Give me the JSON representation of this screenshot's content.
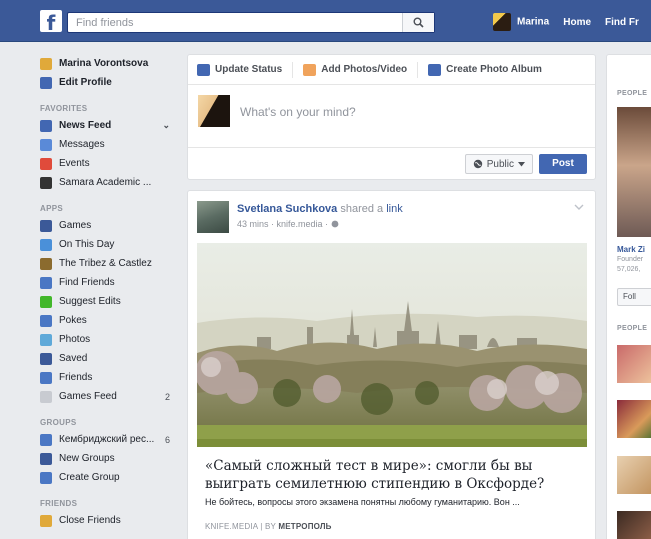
{
  "topbar": {
    "logo": "f",
    "search_placeholder": "Find friends",
    "user_name": "Marina",
    "home_label": "Home",
    "find_friends_label": "Find Fr"
  },
  "sidebar": {
    "profile": [
      {
        "label": "Marina Vorontsova",
        "icon": "avatar",
        "color": "#e0a93a"
      },
      {
        "label": "Edit Profile",
        "icon": "edit-icon",
        "color": "#4267b2"
      }
    ],
    "favorites_heading": "FAVORITES",
    "favorites": [
      {
        "label": "News Feed",
        "icon": "news-feed-icon",
        "color": "#4267b2",
        "count": "⌄"
      },
      {
        "label": "Messages",
        "icon": "messages-icon",
        "color": "#5a8ad8",
        "count": ""
      },
      {
        "label": "Events",
        "icon": "events-icon",
        "color": "#e04b3b",
        "count": ""
      },
      {
        "label": "Samara Academic ...",
        "icon": "group-icon",
        "color": "#333333",
        "count": ""
      }
    ],
    "apps_heading": "APPS",
    "apps": [
      {
        "label": "Games",
        "icon": "games-icon",
        "color": "#3b5998",
        "count": ""
      },
      {
        "label": "On This Day",
        "icon": "on-this-day-icon",
        "color": "#4a90d9",
        "count": ""
      },
      {
        "label": "The Tribez & Castlez",
        "icon": "game-app-icon",
        "color": "#8b6b2e",
        "count": ""
      },
      {
        "label": "Find Friends",
        "icon": "find-friends-icon",
        "color": "#4a77c4",
        "count": ""
      },
      {
        "label": "Suggest Edits",
        "icon": "checkmark-icon",
        "color": "#42b72a",
        "count": ""
      },
      {
        "label": "Pokes",
        "icon": "pokes-icon",
        "color": "#4a77c4",
        "count": ""
      },
      {
        "label": "Photos",
        "icon": "photos-icon",
        "color": "#5fa9d9",
        "count": ""
      },
      {
        "label": "Saved",
        "icon": "saved-icon",
        "color": "#3b5998",
        "count": ""
      },
      {
        "label": "Friends",
        "icon": "friends-icon",
        "color": "#4a77c4",
        "count": ""
      },
      {
        "label": "Games Feed",
        "icon": "games-feed-icon",
        "color": "#c8cbd1",
        "count": "2"
      }
    ],
    "groups_heading": "GROUPS",
    "groups": [
      {
        "label": "Кембриджский рес...",
        "icon": "group-icon",
        "color": "#4a77c4",
        "count": "6"
      },
      {
        "label": "New Groups",
        "icon": "new-groups-icon",
        "color": "#3b5998",
        "count": ""
      },
      {
        "label": "Create Group",
        "icon": "create-group-icon",
        "color": "#4a77c4",
        "count": ""
      }
    ],
    "friends_heading": "FRIENDS",
    "friends": [
      {
        "label": "Close Friends",
        "icon": "star-icon",
        "color": "#e0a93a",
        "count": ""
      }
    ]
  },
  "composer": {
    "tabs": [
      {
        "label": "Update Status",
        "icon": "pencil-icon",
        "color": "#4267b2"
      },
      {
        "label": "Add Photos/Video",
        "icon": "camera-icon",
        "color": "#f0a35c"
      },
      {
        "label": "Create Photo Album",
        "icon": "album-icon",
        "color": "#4267b2"
      }
    ],
    "prompt": "What's on your mind?",
    "privacy_label": "Public",
    "post_label": "Post"
  },
  "story": {
    "author": "Svetlana Suchkova",
    "action": " shared a ",
    "link_word": "link",
    "meta": "43 mins · knife.media · ",
    "title": "«Самый сложный тест в мире»: смогли бы вы выиграть семилетнюю стипендию в Оксфорде?",
    "description": "Не бойтесь, вопросы этого экзамена понятны любому гуманитарию. Вон ...",
    "source_prefix": "KNIFE.MEDIA | BY ",
    "source_author": "МЕТРОПОЛЬ"
  },
  "rightcol": {
    "heading1": "PEOPLE",
    "person_name": "Mark Zi",
    "person_role": "Founder",
    "person_stat": "57,026,",
    "follow_label": "Foll",
    "heading2": "PEOPLE"
  }
}
